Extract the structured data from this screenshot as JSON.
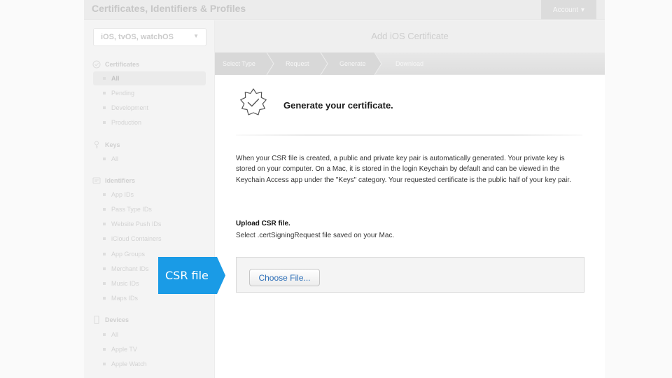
{
  "header": {
    "title": "Certificates, Identifiers & Profiles",
    "account_label": "Account"
  },
  "sidebar": {
    "platform": "iOS, tvOS, watchOS",
    "sections": [
      {
        "title": "Certificates",
        "icon": "certificate-icon",
        "items": [
          "All",
          "Pending",
          "Development",
          "Production"
        ]
      },
      {
        "title": "Keys",
        "icon": "key-icon",
        "items": [
          "All"
        ]
      },
      {
        "title": "Identifiers",
        "icon": "identifier-icon",
        "items": [
          "App IDs",
          "Pass Type IDs",
          "Website Push IDs",
          "iCloud Containers",
          "App Groups",
          "Merchant IDs",
          "Music IDs",
          "Maps IDs"
        ]
      },
      {
        "title": "Devices",
        "icon": "device-icon",
        "items": [
          "All",
          "Apple TV",
          "Apple Watch"
        ]
      }
    ]
  },
  "main": {
    "title": "Add iOS Certificate",
    "steps": [
      "Select Type",
      "Request",
      "Generate",
      "Download"
    ],
    "current_step": "Generate",
    "heading": "Generate your certificate.",
    "description": "When your CSR file is created, a public and private key pair is automatically generated. Your private key is stored on your computer. On a Mac, it is stored in the login Keychain by default and can be viewed in the Keychain Access app under the \"Keys\" category. Your requested certificate is the public half of your key pair.",
    "upload_title": "Upload CSR file.",
    "upload_subtitle": "Select .certSigningRequest file saved on your Mac.",
    "choose_button": "Choose File..."
  },
  "callout": {
    "label": "CSR file",
    "color": "#1a9be6"
  },
  "colors": {
    "accent_link": "#2d6fb8",
    "callout": "#1a9be6"
  }
}
